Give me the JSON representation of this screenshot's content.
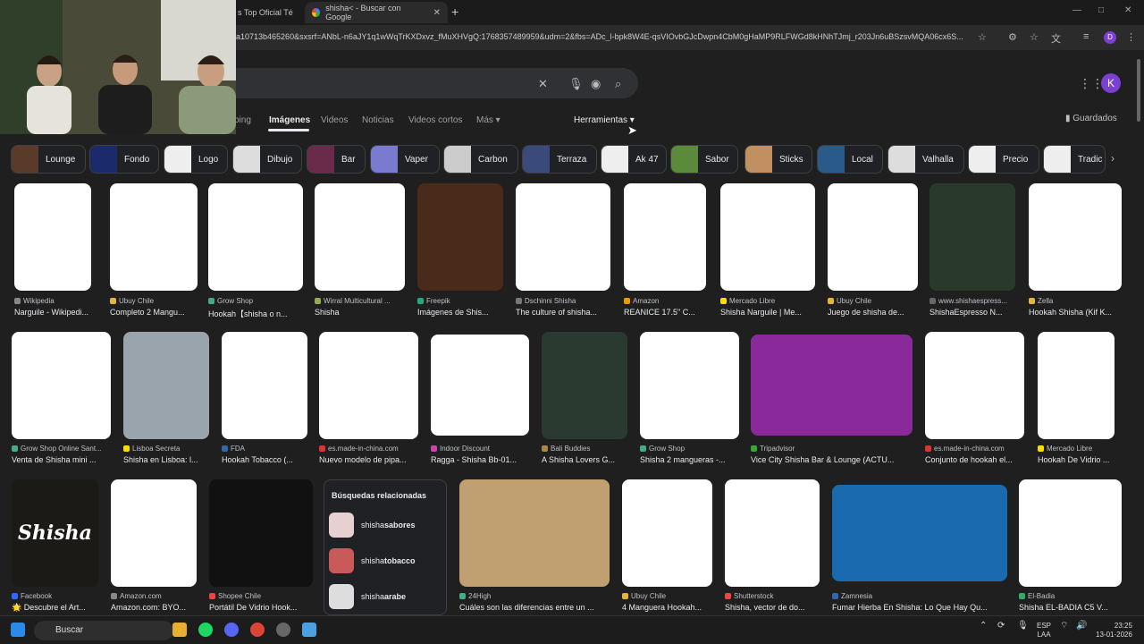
{
  "browser": {
    "tabs": [
      {
        "title": "s Top Oficial Té"
      },
      {
        "title": "shisha< - Buscar con Google"
      }
    ],
    "new_tab": "+",
    "minimize": "—",
    "maximize": "□",
    "close": "✕",
    "url": "a10713b465260&sxsrf=ANbL-n6aJY1q1wWqTrKXDxvz_fMuXHVgQ:1768357489959&udm=2&fbs=ADc_l-bpk8W4E-qsVIOvbGJcDwpn4CbM0gHaMP9RLFWGd8kHNhTJmj_r203Jn6uBSzsvMQA06cx6S...",
    "profile_initial": "D"
  },
  "search": {
    "nav_tabs": [
      "ping",
      "Imágenes",
      "Videos",
      "Noticias",
      "Videos cortos",
      "Más"
    ],
    "tools": "Herramientas",
    "saved": "Guardados",
    "avatar": "K"
  },
  "chips": [
    "Lounge",
    "Fondo",
    "Logo",
    "Dibujo",
    "Bar",
    "Vaper",
    "Carbon",
    "Terraza",
    "Ak 47",
    "Sabor",
    "Sticks",
    "Local",
    "Valhalla",
    "Precio",
    "Tradic"
  ],
  "results_row1": [
    {
      "source": "Wikipedia",
      "title": "Narguile - Wikipedi..."
    },
    {
      "source": "Ubuy Chile",
      "title": "Completo 2 Mangu..."
    },
    {
      "source": "Grow Shop",
      "title": "Hookah【shisha o n..."
    },
    {
      "source": "Wirral Multicultural ...",
      "title": "Shisha"
    },
    {
      "source": "Freepik",
      "title": "Imágenes de Shis..."
    },
    {
      "source": "Dschinni Shisha",
      "title": "The culture of shisha..."
    },
    {
      "source": "Amazon",
      "title": "REANICE 17.5\" C..."
    },
    {
      "source": "Mercado Libre",
      "title": "Shisha Narguile | Me..."
    },
    {
      "source": "Ubuy Chile",
      "title": "Juego de shisha de..."
    },
    {
      "source": "www.shishaespress...",
      "title": "ShishaEspresso N..."
    },
    {
      "source": "Zella",
      "title": "Hookah Shisha (Kif K..."
    }
  ],
  "results_row2": [
    {
      "source": "Grow Shop Online Sant...",
      "title": "Venta de Shisha mini ..."
    },
    {
      "source": "Lisboa Secreta",
      "title": "Shisha en Lisboa: l..."
    },
    {
      "source": "FDA",
      "title": "Hookah Tobacco (..."
    },
    {
      "source": "es.made-in-china.com",
      "title": "Nuevo modelo de pipa..."
    },
    {
      "source": "Indoor Discount",
      "title": "Ragga - Shisha Bb-01..."
    },
    {
      "source": "Bali Buddies",
      "title": "A Shisha Lovers G..."
    },
    {
      "source": "Grow Shop",
      "title": "Shisha 2 mangueras -..."
    },
    {
      "source": "Tripadvisor",
      "title": "Vice City Shisha Bar & Lounge (ACTU..."
    },
    {
      "source": "es.made-in-china.com",
      "title": "Conjunto de hookah el..."
    },
    {
      "source": "Mercado Libre",
      "title": "Hookah De Vidrio ..."
    }
  ],
  "results_row3": [
    {
      "source": "Facebook",
      "title": "🌟 Descubre el Art..."
    },
    {
      "source": "Amazon.com",
      "title": "Amazon.com: BYO..."
    },
    {
      "source": "Shopee Chile",
      "title": "Portátil De Vidrio Hook..."
    },
    {
      "source": "24High",
      "title": "Cuáles son las diferencias entre un ..."
    },
    {
      "source": "Ubuy Chile",
      "title": "4 Manguera Hookah..."
    },
    {
      "source": "Shutterstock",
      "title": "Shisha, vector de do..."
    },
    {
      "source": "Zamnesia",
      "title": "Fumar Hierba En Shisha: Lo Que Hay Qu..."
    },
    {
      "source": "El-Badia",
      "title": "Shisha EL-BADIA C5 V..."
    }
  ],
  "shisha_logo": "Shisha",
  "related": {
    "heading": "Búsquedas relacionadas",
    "items": [
      {
        "prefix": "shisha ",
        "bold": "sabores"
      },
      {
        "prefix": "shisha ",
        "bold": "tobacco"
      },
      {
        "prefix": "shisha ",
        "bold": "arabe"
      }
    ]
  },
  "taskbar": {
    "search": "Buscar",
    "lang1": "ESP",
    "lang2": "LAA",
    "time": "23:25",
    "date": "13-01-2026"
  }
}
